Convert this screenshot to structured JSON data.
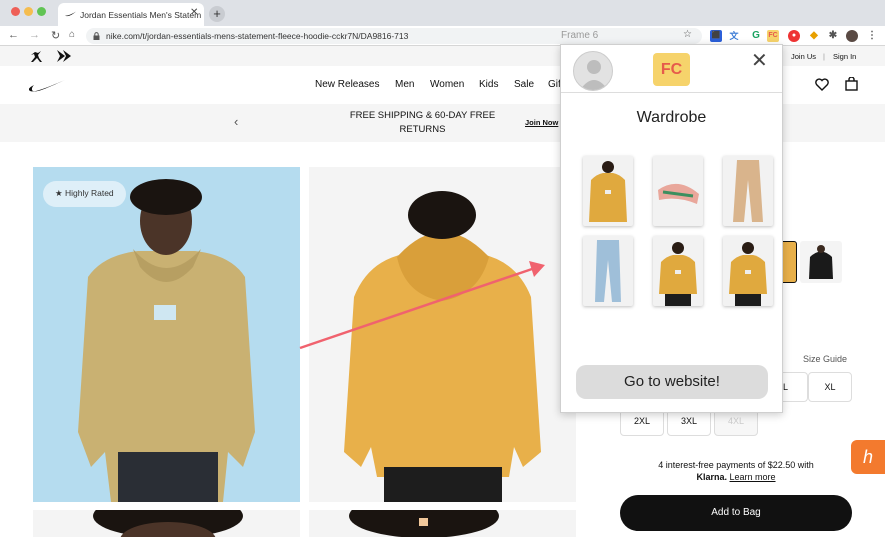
{
  "browser": {
    "tab_title": "Jordan Essentials Men's Statem",
    "url": "nike.com/t/jordan-essentials-mens-statement-fleece-hoodie-cckr7N/DA9816-713",
    "new_tab_symbol": "+"
  },
  "frame_label": "Frame 6",
  "utility": {
    "join_us": "Join Us",
    "sign_in": "Sign In"
  },
  "nav": {
    "items": [
      "New Releases",
      "Men",
      "Women",
      "Kids",
      "Sale",
      "Gift"
    ]
  },
  "promo": {
    "text": "FREE SHIPPING & 60-DAY FREE RETURNS",
    "join_now": "Join Now"
  },
  "product": {
    "badge": "Highly Rated",
    "size_guide": "Size Guide",
    "sizes_row1": [
      "L",
      "XL"
    ],
    "sizes_row2": [
      "2XL",
      "3XL",
      "4XL"
    ],
    "klarna_line1": "4 interest-free payments of $22.50 with",
    "klarna_brand": "Klarna.",
    "klarna_link": "Learn more",
    "add_to_bag": "Add to Bag"
  },
  "popup": {
    "logo": "FC",
    "title": "Wardrobe",
    "items": [
      "hoodie-front",
      "slides",
      "khaki-pants",
      "jeans",
      "hoodie-model",
      "hoodie-model-2"
    ],
    "cta": "Go to website!"
  },
  "colors": {
    "accent_arrow": "#f0626e",
    "highlight": "#b5dcef",
    "hoodie": "#e8b04a",
    "honey": "#f37a2e"
  }
}
